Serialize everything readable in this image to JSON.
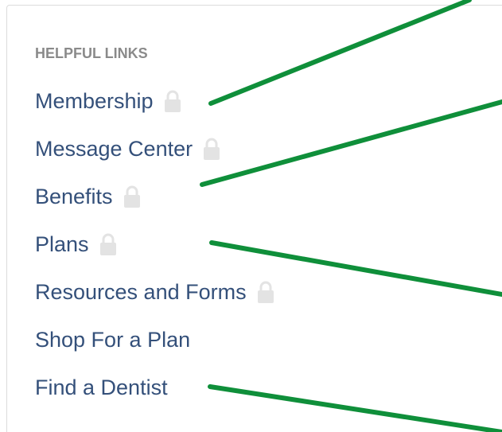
{
  "section": {
    "title": "HELPFUL LINKS"
  },
  "links": [
    {
      "label": "Membership",
      "locked": true
    },
    {
      "label": "Message Center",
      "locked": true
    },
    {
      "label": "Benefits",
      "locked": true
    },
    {
      "label": "Plans",
      "locked": true
    },
    {
      "label": "Resources and Forms",
      "locked": true
    },
    {
      "label": "Shop For a Plan",
      "locked": false
    },
    {
      "label": "Find a Dentist",
      "locked": false
    }
  ],
  "colors": {
    "link": "#34507a",
    "title": "#8a8a8a",
    "lock": "#e3e3e3",
    "annotation_line": "#0f8f3a"
  },
  "icons": {
    "lock": "lock-icon"
  }
}
